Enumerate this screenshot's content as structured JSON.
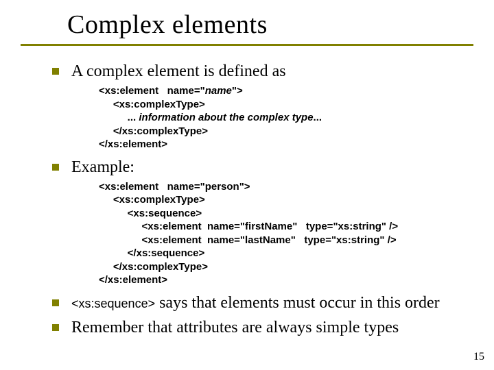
{
  "title": "Complex elements",
  "bullets": {
    "b1": "A complex element is defined as",
    "b2": "Example:",
    "b3_pre": "<xs:sequence>",
    "b3_post": " says that elements must occur in this order",
    "b4": "Remember that attributes are always simple types"
  },
  "code1": {
    "l1a": "<xs:element   name=\"",
    "l1b": "name",
    "l1c": "\">",
    "l2": "     <xs:complexType>",
    "l3a": "          ... ",
    "l3b": "information about the complex type",
    "l3c": "...",
    "l4": "     </xs:complexType>",
    "l5": "</xs:element>"
  },
  "code2": {
    "l1": "<xs:element   name=\"person\">",
    "l2": "     <xs:complexType>",
    "l3": "          <xs:sequence>",
    "l4": "               <xs:element  name=\"firstName\"   type=\"xs:string\" />",
    "l5": "               <xs:element  name=\"lastName\"   type=\"xs:string\" />",
    "l6": "          </xs:sequence>",
    "l7": "     </xs:complexType>",
    "l8": "</xs:element>"
  },
  "pagenum": "15"
}
